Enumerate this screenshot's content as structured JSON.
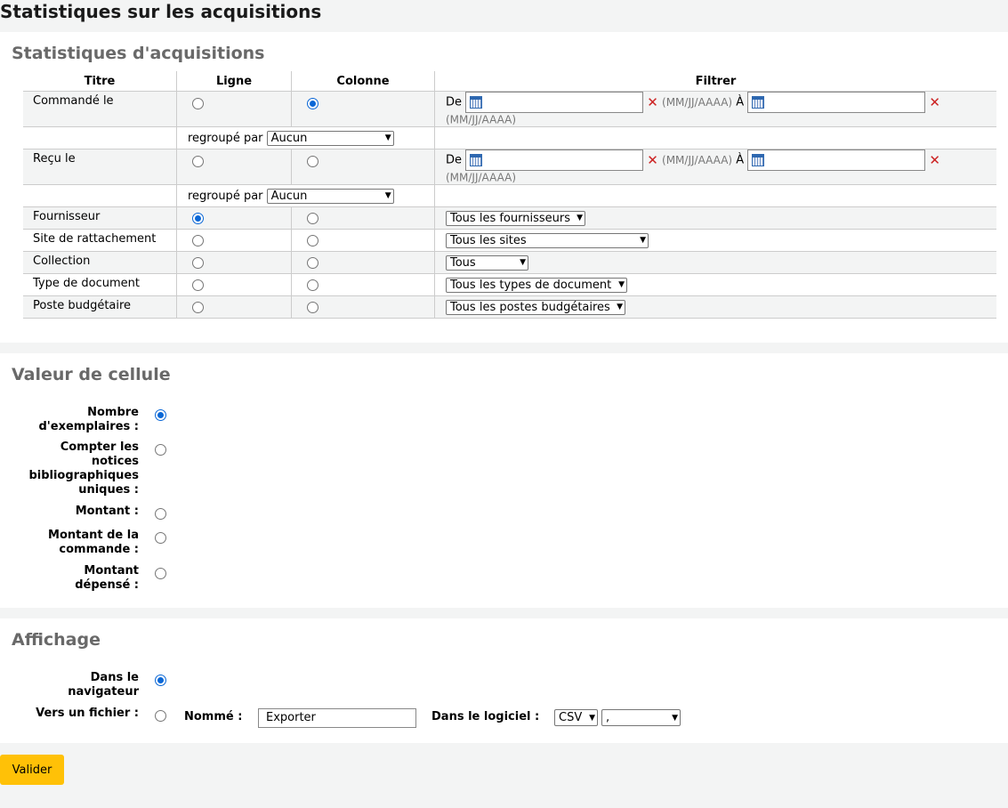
{
  "page_title": "Statistiques sur les acquisitions",
  "acq": {
    "heading": "Statistiques d'acquisitions",
    "columns": [
      "Titre",
      "Ligne",
      "Colonne",
      "Filtrer"
    ],
    "date_from": "De",
    "date_to": "À",
    "date_hint": "(MM/JJ/AAAA)",
    "clear_symbol": "✕",
    "grouped_label": "regroupé par",
    "group_value": "Aucun",
    "rows": {
      "ordered": "Commandé le",
      "received": "Reçu le",
      "supplier": "Fournisseur",
      "library": "Site de rattachement",
      "collection": "Collection",
      "doctype": "Type de document",
      "budget": "Poste budgétaire"
    },
    "filters": {
      "supplier": "Tous les fournisseurs",
      "library": "Tous les sites",
      "collection": "Tous",
      "doctype": "Tous les types de document",
      "budget": "Tous les postes budgétaires"
    }
  },
  "cell": {
    "heading": "Valeur de cellule",
    "options": {
      "items": "Nombre d'exemplaires :",
      "biblios": "Compter les notices bibliographiques uniques :",
      "amount": "Montant :",
      "order_amount": "Montant de la commande :",
      "spent": "Montant dépensé :"
    }
  },
  "display": {
    "heading": "Affichage",
    "browser": "Dans le navigateur",
    "file": "Vers un fichier :",
    "named_label": "Nommé :",
    "named_value": "Exporter",
    "software_label": "Dans le logiciel :",
    "format": "CSV",
    "separator": ","
  },
  "submit": "Valider"
}
